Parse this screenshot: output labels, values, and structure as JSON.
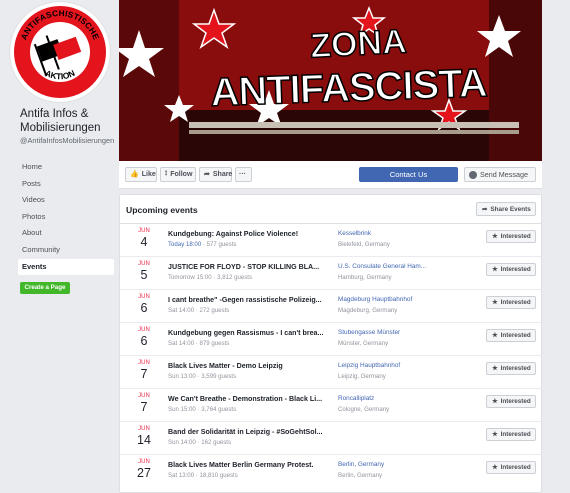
{
  "page": {
    "name": "Antifa Infos & Mobilisierungen",
    "handle": "@AntifaInfosMobilisierungen"
  },
  "logo": {
    "text_top": "ANTIFASCHISTISCHE",
    "text_bottom": "AKTION"
  },
  "cover": {
    "line1": "ZONA",
    "line2": "ANTIFASCISTA"
  },
  "nav": {
    "items": [
      {
        "label": "Home"
      },
      {
        "label": "Posts"
      },
      {
        "label": "Videos"
      },
      {
        "label": "Photos"
      },
      {
        "label": "About"
      },
      {
        "label": "Community"
      },
      {
        "label": "Events"
      }
    ],
    "active": "Events",
    "create_page": "Create a Page"
  },
  "actions": {
    "like": "Like",
    "follow": "Follow",
    "share": "Share",
    "more": "···",
    "contact": "Contact Us",
    "send_message": "Send Message"
  },
  "events": {
    "title": "Upcoming events",
    "share_button": "Share Events",
    "interested_label": "Interested",
    "list": [
      {
        "month": "JUN",
        "day": "4",
        "title": "Kundgebung: Against Police Violence!",
        "time_highlight": "Today 18:00",
        "time": "",
        "guests": "577 guests",
        "place": "Kesselbrink",
        "city": "Bielefeld, Germany"
      },
      {
        "month": "JUN",
        "day": "5",
        "title": "JUSTICE FOR FLOYD - STOP KILLING BLA...",
        "time_highlight": "",
        "time": "Tomorrow 15:00",
        "guests": "3,812 guests",
        "place": "U.S. Consulate General Ham...",
        "city": "Hamburg, Germany"
      },
      {
        "month": "JUN",
        "day": "6",
        "title": "I cant breathe\" -Gegen rassistische Polizeig...",
        "time_highlight": "",
        "time": "Sat 14:00",
        "guests": "272 guests",
        "place": "Magdeburg Hauptbahnhof",
        "city": "Magdeburg, Germany"
      },
      {
        "month": "JUN",
        "day": "6",
        "title": "Kundgebung gegen Rassismus - I can't brea...",
        "time_highlight": "",
        "time": "Sat 14:00",
        "guests": "879 guests",
        "place": "Stubengasse Münster",
        "city": "Münster, Germany"
      },
      {
        "month": "JUN",
        "day": "7",
        "title": "Black Lives Matter - Demo Leipzig",
        "time_highlight": "",
        "time": "Sun 13:00",
        "guests": "3,599 guests",
        "place": "Leipzig Hauptbahnhof",
        "city": "Leipzig, Germany"
      },
      {
        "month": "JUN",
        "day": "7",
        "title": "We Can't Breathe - Demonstration - Black Li...",
        "time_highlight": "",
        "time": "Sun 15:00",
        "guests": "3,764 guests",
        "place": "Roncalliplatz",
        "city": "Cologne, Germany"
      },
      {
        "month": "JUN",
        "day": "14",
        "title": "Band der Solidarität in Leipzig - #SoGehtSol...",
        "time_highlight": "",
        "time": "Sun 14:00",
        "guests": "162 guests",
        "place": "",
        "city": ""
      },
      {
        "month": "JUN",
        "day": "27",
        "title": "Black Lives Matter Berlin Germany Protest.",
        "time_highlight": "",
        "time": "Sat 13:00",
        "guests": "18,810 guests",
        "place": "Berlin, Germany",
        "city": "Berlin, Germany"
      }
    ]
  },
  "colors": {
    "fb_blue": "#4267b2",
    "date_red": "#f02849",
    "create_green": "#42b72a",
    "antifa_red": "#e3141c"
  }
}
